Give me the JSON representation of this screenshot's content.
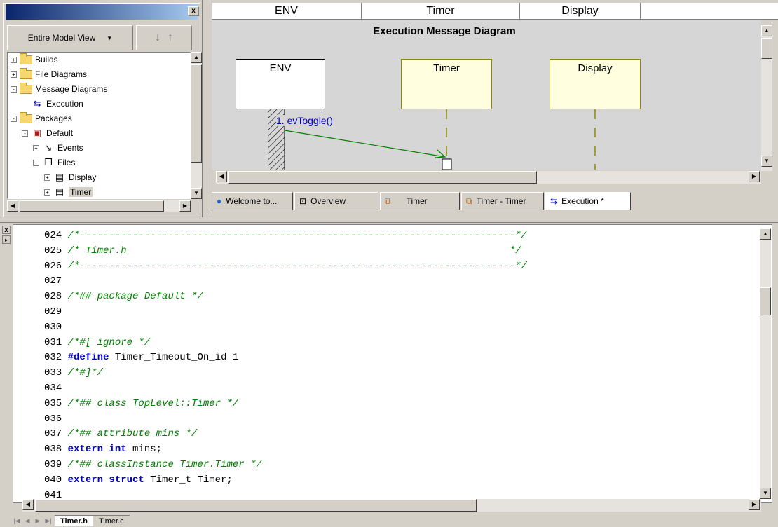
{
  "browser": {
    "close_label": "x",
    "view_combo": "Entire Model View",
    "tree": [
      {
        "label": "Builds",
        "icon": "folder-icon",
        "expander": "+",
        "level": 0
      },
      {
        "label": "File Diagrams",
        "icon": "folder-icon",
        "expander": "+",
        "level": 0
      },
      {
        "label": "Message Diagrams",
        "icon": "folder-icon",
        "expander": "-",
        "level": 0
      },
      {
        "label": "Execution",
        "icon": "sequence-diagram-icon",
        "expander": "",
        "level": 1
      },
      {
        "label": "Packages",
        "icon": "folder-icon",
        "expander": "-",
        "level": 0
      },
      {
        "label": "Default",
        "icon": "package-icon",
        "expander": "-",
        "level": 1
      },
      {
        "label": "Events",
        "icon": "event-icon",
        "expander": "+",
        "level": 2
      },
      {
        "label": "Files",
        "icon": "files-icon",
        "expander": "-",
        "level": 2
      },
      {
        "label": "Display",
        "icon": "file-icon",
        "expander": "+",
        "level": 3
      },
      {
        "label": "Timer",
        "icon": "file-icon",
        "expander": "+",
        "level": 3
      }
    ]
  },
  "diagram": {
    "column_headers": [
      "ENV",
      "Timer",
      "Display"
    ],
    "title": "Execution Message Diagram",
    "lifelines": [
      "ENV",
      "Timer",
      "Display"
    ],
    "message": "1. evToggle()",
    "colors": {
      "env_box": "#ffffff",
      "instance_box": "#ffffe0",
      "instance_border": "#8b8b00",
      "message": "#008000"
    }
  },
  "doc_tabs": [
    {
      "label": "Welcome to...",
      "icon": "globe-icon"
    },
    {
      "label": "Overview",
      "icon": "class-diagram-icon"
    },
    {
      "label": "Timer",
      "icon": "statechart-icon"
    },
    {
      "label": "Timer - Timer",
      "icon": "statechart-icon"
    },
    {
      "label": "Execution *",
      "icon": "sequence-diagram-icon"
    }
  ],
  "editor": {
    "lines": [
      {
        "n": "024",
        "parts": [
          {
            "t": " /*--------------------------------------------------------------------------*/",
            "c": "cm"
          }
        ]
      },
      {
        "n": "025",
        "parts": [
          {
            "t": " /* Timer.h                                                                 */",
            "c": "cm"
          }
        ]
      },
      {
        "n": "026",
        "parts": [
          {
            "t": " /*--------------------------------------------------------------------------*/",
            "c": "cm"
          }
        ]
      },
      {
        "n": "027",
        "parts": []
      },
      {
        "n": "028",
        "parts": [
          {
            "t": " /*## package Default */",
            "c": "cm"
          }
        ]
      },
      {
        "n": "029",
        "parts": []
      },
      {
        "n": "030",
        "parts": []
      },
      {
        "n": "031",
        "parts": [
          {
            "t": " /*#[ ignore */",
            "c": "cm"
          }
        ]
      },
      {
        "n": "032",
        "parts": [
          {
            "t": " #define",
            "c": "kw"
          },
          {
            "t": " Timer_Timeout_On_id 1",
            "c": ""
          }
        ]
      },
      {
        "n": "033",
        "parts": [
          {
            "t": " /*#]*/",
            "c": "cm"
          }
        ]
      },
      {
        "n": "034",
        "parts": []
      },
      {
        "n": "035",
        "parts": [
          {
            "t": " /*## class TopLevel::Timer */",
            "c": "cm"
          }
        ]
      },
      {
        "n": "036",
        "parts": []
      },
      {
        "n": "037",
        "parts": [
          {
            "t": " /*## attribute mins */",
            "c": "cm"
          }
        ]
      },
      {
        "n": "038",
        "parts": [
          {
            "t": " extern int",
            "c": "kw"
          },
          {
            "t": " mins;",
            "c": ""
          }
        ]
      },
      {
        "n": "039",
        "parts": [
          {
            "t": " /*## classInstance Timer.Timer */",
            "c": "cm"
          }
        ]
      },
      {
        "n": "040",
        "parts": [
          {
            "t": " extern struct",
            "c": "kw"
          },
          {
            "t": " Timer_t Timer;",
            "c": ""
          }
        ]
      },
      {
        "n": "041",
        "parts": []
      }
    ]
  },
  "file_tabs": [
    "Timer.h",
    "Timer.c"
  ]
}
